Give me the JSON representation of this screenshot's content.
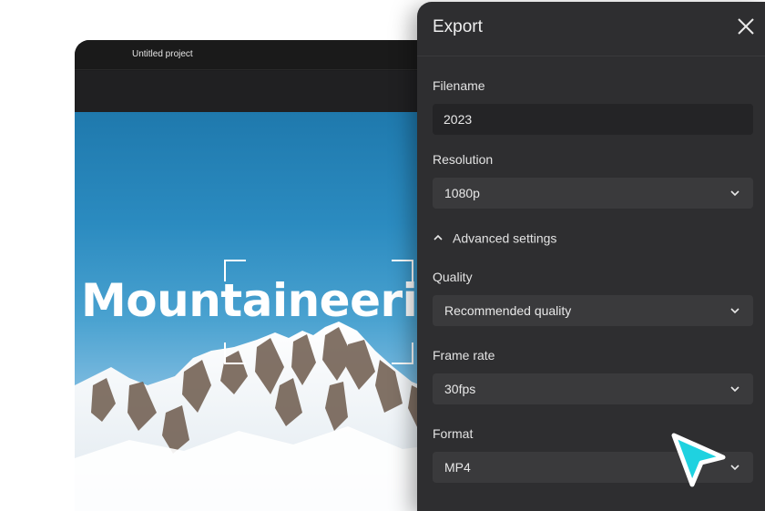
{
  "editor": {
    "title": "Untitled project",
    "headline": "Mountaineering"
  },
  "export_panel": {
    "title": "Export",
    "close_icon": "close-icon",
    "filename": {
      "label": "Filename",
      "value": "2023"
    },
    "resolution": {
      "label": "Resolution",
      "value": "1080p"
    },
    "advanced": {
      "label": "Advanced settings",
      "icon": "chevron-up-icon"
    },
    "quality": {
      "label": "Quality",
      "value": "Recommended quality"
    },
    "frame_rate": {
      "label": "Frame rate",
      "value": "30fps"
    },
    "format": {
      "label": "Format",
      "value": "MP4"
    }
  },
  "colors": {
    "panel_bg": "#2e2e30",
    "field_bg": "#3a3a3c",
    "cursor": "#1fd2e0"
  }
}
